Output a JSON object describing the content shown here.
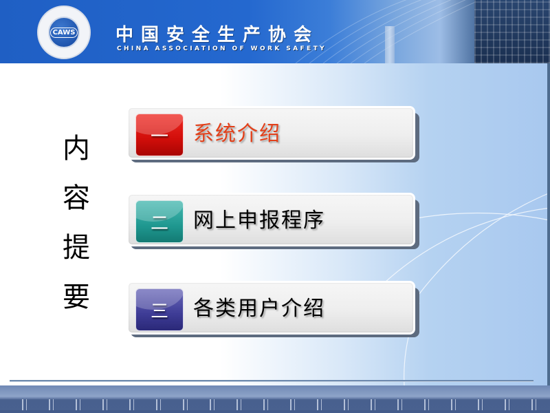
{
  "header": {
    "logo_text": "CAWS",
    "org_name_cn": "中国安全生产协会",
    "org_name_en": "CHINA ASSOCIATION OF WORK SAFETY"
  },
  "vertical_title": [
    "内",
    "容",
    "提",
    "要"
  ],
  "items": [
    {
      "number": "一",
      "label": "系统介绍",
      "badge_color": "#d10e0a",
      "label_color": "#e2401a"
    },
    {
      "number": "二",
      "label": "网上申报程序",
      "badge_color": "#1f9890",
      "label_color": "#000000"
    },
    {
      "number": "三",
      "label": "各类用户介绍",
      "badge_color": "#3e3c96",
      "label_color": "#000000"
    }
  ],
  "colors": {
    "header_blue": "#2468cf",
    "divider": "#6d89ad"
  }
}
